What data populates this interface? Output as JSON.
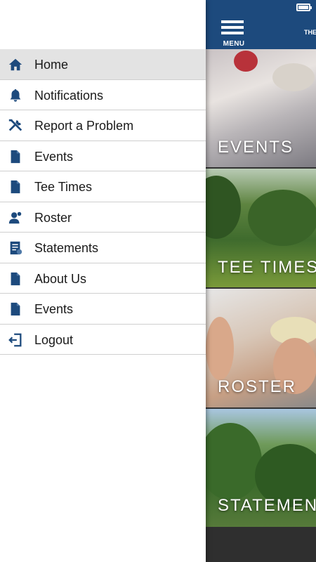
{
  "app": {
    "title_partial": "THE",
    "menu_label": "MENU"
  },
  "drawer": {
    "items": [
      {
        "label": "Home",
        "icon": "home-icon"
      },
      {
        "label": "Notifications",
        "icon": "bell-icon"
      },
      {
        "label": "Report a Problem",
        "icon": "tools-icon"
      },
      {
        "label": "Events",
        "icon": "document-icon"
      },
      {
        "label": "Tee Times",
        "icon": "document-icon"
      },
      {
        "label": "Roster",
        "icon": "person-icon"
      },
      {
        "label": "Statements",
        "icon": "statement-icon"
      },
      {
        "label": "About Us",
        "icon": "document-icon"
      },
      {
        "label": "Events",
        "icon": "document-icon"
      },
      {
        "label": "Logout",
        "icon": "logout-icon"
      }
    ],
    "active_index": 0
  },
  "tiles": [
    {
      "label": "EVENTS"
    },
    {
      "label": "TEE TIMES"
    },
    {
      "label": "ROSTER"
    },
    {
      "label": "STATEMENTS"
    }
  ],
  "colors": {
    "brand": "#1d4a7d",
    "icon": "#1d4a7d",
    "active_bg": "#e3e3e3"
  }
}
